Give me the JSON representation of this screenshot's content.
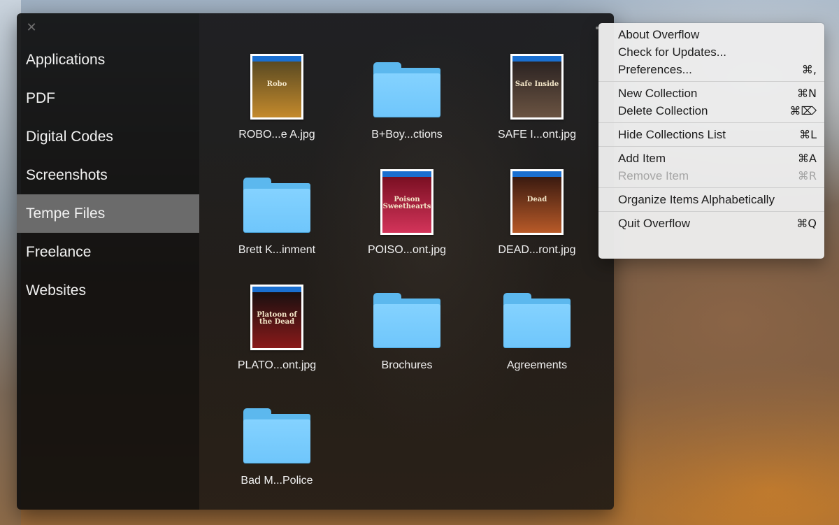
{
  "window": {
    "close_glyph": "✕"
  },
  "sidebar": {
    "items": [
      {
        "label": "Applications",
        "selected": false
      },
      {
        "label": "PDF",
        "selected": false
      },
      {
        "label": "Digital Codes",
        "selected": false
      },
      {
        "label": "Screenshots",
        "selected": false
      },
      {
        "label": "Tempe Files",
        "selected": true
      },
      {
        "label": "Freelance",
        "selected": false
      },
      {
        "label": "Websites",
        "selected": false
      }
    ]
  },
  "grid": {
    "items": [
      {
        "label": "ROBO...e A.jpg",
        "kind": "image",
        "art_text": "Robo",
        "art_colors": [
          "#5a4a22",
          "#c48a2c"
        ]
      },
      {
        "label": "B+Boy...ctions",
        "kind": "folder"
      },
      {
        "label": "SAFE I...ont.jpg",
        "kind": "image",
        "art_text": "Safe Inside",
        "art_colors": [
          "#2b2322",
          "#6b5442"
        ]
      },
      {
        "label": "Brett K...inment",
        "kind": "folder"
      },
      {
        "label": "POISO...ont.jpg",
        "kind": "image",
        "art_text": "Poison Sweethearts",
        "art_colors": [
          "#7a0f22",
          "#d3345a"
        ]
      },
      {
        "label": "DEAD...ront.jpg",
        "kind": "image",
        "art_text": "Dead",
        "art_colors": [
          "#3a1a10",
          "#b85a28"
        ]
      },
      {
        "label": "PLATO...ont.jpg",
        "kind": "image",
        "art_text": "Platoon of the Dead",
        "art_colors": [
          "#1a1010",
          "#8a1a1a"
        ]
      },
      {
        "label": "Brochures",
        "kind": "folder"
      },
      {
        "label": "Agreements",
        "kind": "folder"
      },
      {
        "label": "Bad M...Police",
        "kind": "folder"
      }
    ]
  },
  "menu": {
    "groups": [
      [
        {
          "label": "About Overflow",
          "shortcut": "",
          "disabled": false
        },
        {
          "label": "Check for Updates...",
          "shortcut": "",
          "disabled": false
        },
        {
          "label": "Preferences...",
          "shortcut": "⌘,",
          "disabled": false
        }
      ],
      [
        {
          "label": "New Collection",
          "shortcut": "⌘N",
          "disabled": false
        },
        {
          "label": "Delete Collection",
          "shortcut": "⌘⌦",
          "disabled": false
        }
      ],
      [
        {
          "label": "Hide Collections List",
          "shortcut": "⌘L",
          "disabled": false
        }
      ],
      [
        {
          "label": "Add Item",
          "shortcut": "⌘A",
          "disabled": false
        },
        {
          "label": "Remove Item",
          "shortcut": "⌘R",
          "disabled": true
        }
      ],
      [
        {
          "label": "Organize Items Alphabetically",
          "shortcut": "",
          "disabled": false
        }
      ],
      [
        {
          "label": "Quit Overflow",
          "shortcut": "⌘Q",
          "disabled": false
        }
      ]
    ]
  },
  "colors": {
    "folder": "#6fc6fb",
    "selection": "#6b6b6b",
    "bluray_band": "#1a6fd0"
  }
}
